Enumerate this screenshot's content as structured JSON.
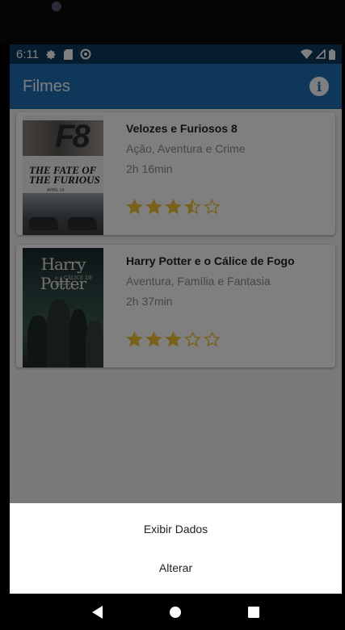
{
  "status_bar": {
    "time": "6:11"
  },
  "app_bar": {
    "title": "Filmes",
    "info_icon": "info-icon"
  },
  "movies": [
    {
      "title": "Velozes e Furiosos 8",
      "genre": "Ação, Aventura e Crime",
      "duration": "2h 16min",
      "rating": 3.5,
      "max_rating": 5,
      "poster": {
        "big_text": "F8",
        "title_text": "THE FATE OF THE FURIOUS",
        "date_text": "APRIL 14"
      }
    },
    {
      "title": "Harry Potter e o Cálice de Fogo",
      "genre": "Aventura, Família e Fantasia",
      "duration": "2h 37min",
      "rating": 3,
      "max_rating": 5,
      "poster": {
        "big_text": "Harry Potter",
        "sub_text": "e o CÁLICE DE FOGO"
      }
    }
  ],
  "bottom_sheet": {
    "items": [
      "Exibir Dados",
      "Alterar"
    ]
  },
  "colors": {
    "app_bar": "#1f6fb3",
    "status_bar": "#0d3a5e",
    "star": "#f2c230"
  }
}
